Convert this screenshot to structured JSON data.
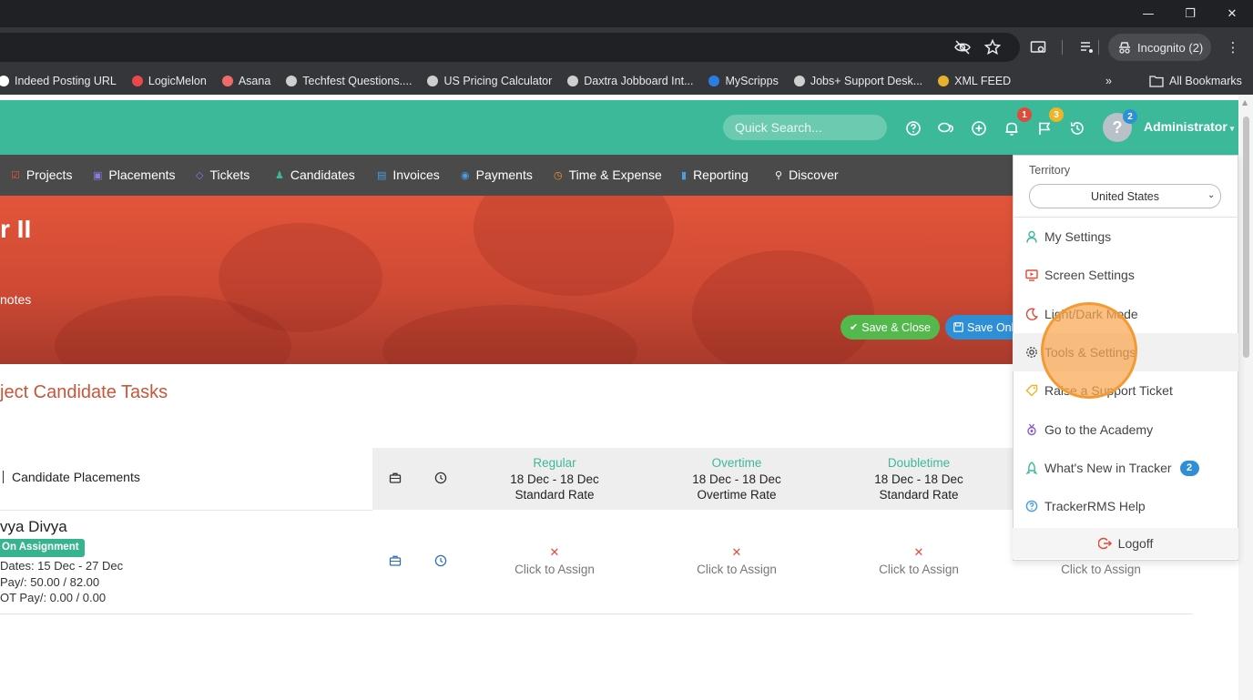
{
  "browser": {
    "window_controls": {
      "minimize": "—",
      "restore": "❐",
      "close": "✕"
    },
    "toolbar_icons": [
      "eye-off-icon",
      "star-icon",
      "cast-icon",
      "media-icon"
    ],
    "incognito_label": "Incognito (2)",
    "bookmarks": [
      {
        "label": "Indeed Posting URL",
        "color": "#ffffff"
      },
      {
        "label": "LogicMelon",
        "color": "#e94949"
      },
      {
        "label": "Asana",
        "color": "#f06a6a"
      },
      {
        "label": "Techfest Questions....",
        "color": "#cfcfcf"
      },
      {
        "label": "US Pricing Calculator",
        "color": "#cfcfcf"
      },
      {
        "label": "Daxtra Jobboard Int...",
        "color": "#cfcfcf"
      },
      {
        "label": "MyScripps",
        "color": "#2d7de0"
      },
      {
        "label": "Jobs+ Support Desk...",
        "color": "#cfcfcf"
      },
      {
        "label": "XML FEED",
        "color": "#e6b22a"
      }
    ],
    "more_bookmarks": "»",
    "all_bookmarks_label": "All Bookmarks"
  },
  "header": {
    "search_placeholder": "Quick Search...",
    "icons": [
      "help-icon",
      "chat-icon",
      "add-icon",
      "bell-icon",
      "flag-icon",
      "history-icon"
    ],
    "notifications_count": "1",
    "flags_count": "3",
    "avatar_count": "2",
    "avatar_glyph": "?",
    "user_name": "Administrator",
    "accent": "#3cb998"
  },
  "nav": {
    "items": [
      {
        "label": "Projects",
        "icon": "☑",
        "color": "#e2553a"
      },
      {
        "label": "Placements",
        "icon": "▣",
        "color": "#8b7be0"
      },
      {
        "label": "Tickets",
        "icon": "◇",
        "color": "#8b7be0"
      },
      {
        "label": "Candidates",
        "icon": "♟",
        "color": "#3cb998"
      },
      {
        "label": "Invoices",
        "icon": "▤",
        "color": "#4a9de0"
      },
      {
        "label": "Payments",
        "icon": "◉",
        "color": "#4a9de0"
      },
      {
        "label": "Time & Expense",
        "icon": "◷",
        "color": "#f0932b"
      },
      {
        "label": "Reporting",
        "icon": "▮",
        "color": "#4a9de0"
      },
      {
        "label": "Discover",
        "icon": "⚲",
        "color": "#ffffff"
      }
    ]
  },
  "banner": {
    "title": "r II",
    "subtitle": "notes",
    "save_close_label": "Save & Close",
    "save_only_label": "Save Onl"
  },
  "main": {
    "heading": "ject Candidate Tasks",
    "left_header": "Candidate Placements",
    "columns": [
      {
        "name": "Regular",
        "dates": "18 Dec - 18 Dec",
        "rate": "Standard Rate"
      },
      {
        "name": "Overtime",
        "dates": "18 Dec - 18 Dec",
        "rate": "Overtime Rate"
      },
      {
        "name": "Doubletime",
        "dates": "18 Dec - 18 Dec",
        "rate": "Standard Rate"
      }
    ],
    "row": {
      "candidate": "vya Divya",
      "status": "On Assignment",
      "dates": "Dates: 15 Dec - 27 Dec",
      "pay": "Pay/: 50.00 / 82.00",
      "ot_pay": "OT Pay/: 0.00 / 0.00",
      "assign_mark": "✕",
      "assign_label": "Click to Assign"
    }
  },
  "dropdown": {
    "territory_label": "Territory",
    "territory_value": "United States",
    "items": [
      {
        "label": "My Settings",
        "icon": "person-icon"
      },
      {
        "label": "Screen Settings",
        "icon": "monitor-icon"
      },
      {
        "label": "Light/Dark Mode",
        "icon": "moon-icon"
      },
      {
        "label": "Tools & Settings",
        "icon": "gear-icon"
      },
      {
        "label": "Raise a Support Ticket",
        "icon": "tag-icon"
      },
      {
        "label": "Go to the Academy",
        "icon": "medal-icon"
      },
      {
        "label": "What's New in Tracker",
        "icon": "rocket-icon",
        "count": "2"
      },
      {
        "label": "TrackerRMS Help",
        "icon": "help-circle-icon"
      }
    ],
    "logoff_label": "Logoff"
  }
}
